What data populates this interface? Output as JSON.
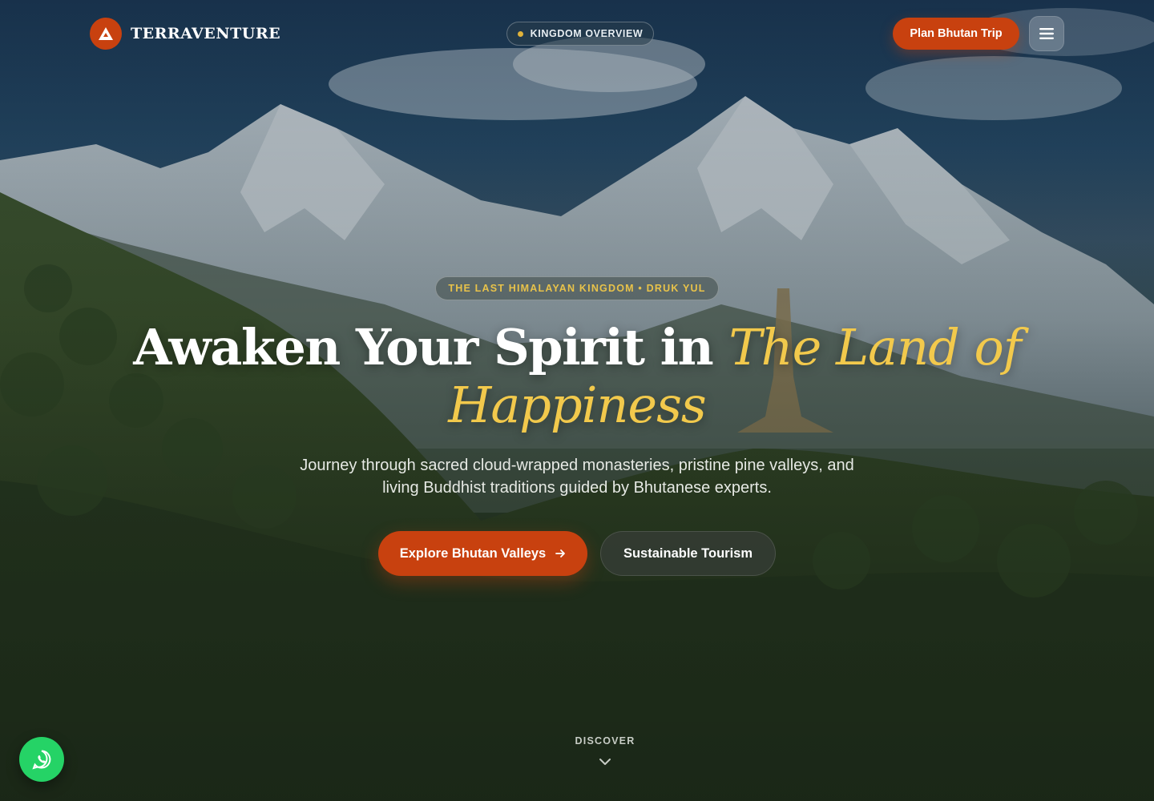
{
  "brand": {
    "name": "TERRAVENTURE",
    "icon": "mountain-icon"
  },
  "nav": {
    "pill_label": "KINGDOM OVERVIEW",
    "cta_label": "Plan Bhutan Trip",
    "menu_icon": "hamburger-icon"
  },
  "hero": {
    "eyebrow": "THE LAST HIMALAYAN KINGDOM • DRUK YUL",
    "title_plain": "Awaken Your Spirit in ",
    "title_accent": "The Land of Happiness",
    "subtitle": "Journey through sacred cloud-wrapped monasteries, pristine pine valleys, and living Buddhist traditions guided by Bhutanese experts.",
    "primary_cta": "Explore Bhutan Valleys",
    "secondary_cta": "Sustainable Tourism",
    "scroll_label": "DISCOVER"
  },
  "floating": {
    "whatsapp_icon": "whatsapp-icon"
  },
  "colors": {
    "brand_orange": "#c8410f",
    "accent_gold": "#f2c94c",
    "eyebrow_gold": "#e8c24a",
    "whatsapp_green": "#25d366"
  }
}
